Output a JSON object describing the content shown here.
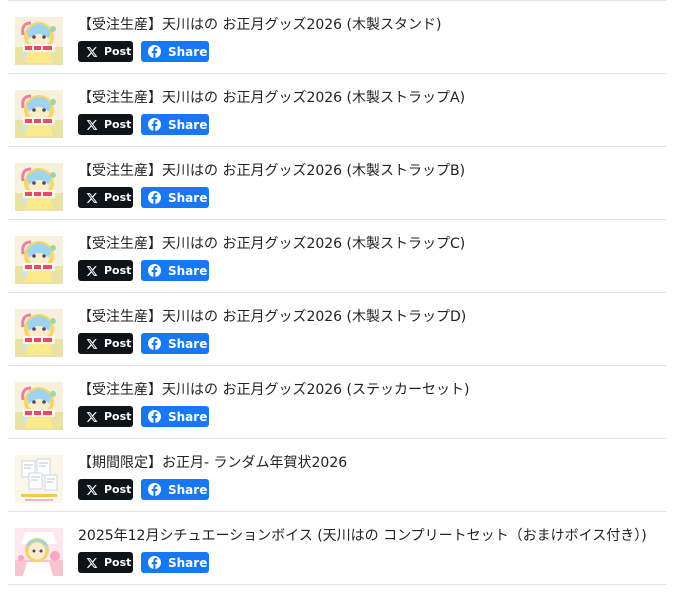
{
  "share": {
    "x_label": "Post",
    "facebook_label": "Share"
  },
  "items": [
    {
      "title": "【受注生産】天川はの お正月グッズ2026 (木製スタンド)",
      "thumb": "character"
    },
    {
      "title": "【受注生産】天川はの お正月グッズ2026 (木製ストラップA)",
      "thumb": "character"
    },
    {
      "title": "【受注生産】天川はの お正月グッズ2026 (木製ストラップB)",
      "thumb": "character"
    },
    {
      "title": "【受注生産】天川はの お正月グッズ2026 (木製ストラップC)",
      "thumb": "character"
    },
    {
      "title": "【受注生産】天川はの お正月グッズ2026 (木製ストラップD)",
      "thumb": "character"
    },
    {
      "title": "【受注生産】天川はの お正月グッズ2026 (ステッカーセット)",
      "thumb": "character"
    },
    {
      "title": "【期間限定】お正月- ランダム年賀状2026",
      "thumb": "cards"
    },
    {
      "title": "2025年12月シチュエーションボイス (天川はの コンプリートセット（おまけボイス付き）)",
      "thumb": "voice"
    }
  ],
  "colors": {
    "x_button": "#0f1419",
    "facebook_button": "#1877f2",
    "divider": "#e2e2e2"
  }
}
